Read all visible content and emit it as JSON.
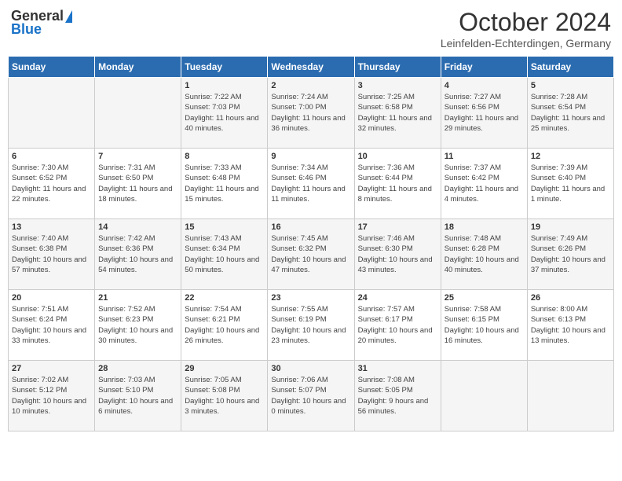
{
  "header": {
    "logo_general": "General",
    "logo_blue": "Blue",
    "month_title": "October 2024",
    "location": "Leinfelden-Echterdingen, Germany"
  },
  "days_of_week": [
    "Sunday",
    "Monday",
    "Tuesday",
    "Wednesday",
    "Thursday",
    "Friday",
    "Saturday"
  ],
  "weeks": [
    [
      {
        "day": "",
        "info": ""
      },
      {
        "day": "",
        "info": ""
      },
      {
        "day": "1",
        "info": "Sunrise: 7:22 AM\nSunset: 7:03 PM\nDaylight: 11 hours and 40 minutes."
      },
      {
        "day": "2",
        "info": "Sunrise: 7:24 AM\nSunset: 7:00 PM\nDaylight: 11 hours and 36 minutes."
      },
      {
        "day": "3",
        "info": "Sunrise: 7:25 AM\nSunset: 6:58 PM\nDaylight: 11 hours and 32 minutes."
      },
      {
        "day": "4",
        "info": "Sunrise: 7:27 AM\nSunset: 6:56 PM\nDaylight: 11 hours and 29 minutes."
      },
      {
        "day": "5",
        "info": "Sunrise: 7:28 AM\nSunset: 6:54 PM\nDaylight: 11 hours and 25 minutes."
      }
    ],
    [
      {
        "day": "6",
        "info": "Sunrise: 7:30 AM\nSunset: 6:52 PM\nDaylight: 11 hours and 22 minutes."
      },
      {
        "day": "7",
        "info": "Sunrise: 7:31 AM\nSunset: 6:50 PM\nDaylight: 11 hours and 18 minutes."
      },
      {
        "day": "8",
        "info": "Sunrise: 7:33 AM\nSunset: 6:48 PM\nDaylight: 11 hours and 15 minutes."
      },
      {
        "day": "9",
        "info": "Sunrise: 7:34 AM\nSunset: 6:46 PM\nDaylight: 11 hours and 11 minutes."
      },
      {
        "day": "10",
        "info": "Sunrise: 7:36 AM\nSunset: 6:44 PM\nDaylight: 11 hours and 8 minutes."
      },
      {
        "day": "11",
        "info": "Sunrise: 7:37 AM\nSunset: 6:42 PM\nDaylight: 11 hours and 4 minutes."
      },
      {
        "day": "12",
        "info": "Sunrise: 7:39 AM\nSunset: 6:40 PM\nDaylight: 11 hours and 1 minute."
      }
    ],
    [
      {
        "day": "13",
        "info": "Sunrise: 7:40 AM\nSunset: 6:38 PM\nDaylight: 10 hours and 57 minutes."
      },
      {
        "day": "14",
        "info": "Sunrise: 7:42 AM\nSunset: 6:36 PM\nDaylight: 10 hours and 54 minutes."
      },
      {
        "day": "15",
        "info": "Sunrise: 7:43 AM\nSunset: 6:34 PM\nDaylight: 10 hours and 50 minutes."
      },
      {
        "day": "16",
        "info": "Sunrise: 7:45 AM\nSunset: 6:32 PM\nDaylight: 10 hours and 47 minutes."
      },
      {
        "day": "17",
        "info": "Sunrise: 7:46 AM\nSunset: 6:30 PM\nDaylight: 10 hours and 43 minutes."
      },
      {
        "day": "18",
        "info": "Sunrise: 7:48 AM\nSunset: 6:28 PM\nDaylight: 10 hours and 40 minutes."
      },
      {
        "day": "19",
        "info": "Sunrise: 7:49 AM\nSunset: 6:26 PM\nDaylight: 10 hours and 37 minutes."
      }
    ],
    [
      {
        "day": "20",
        "info": "Sunrise: 7:51 AM\nSunset: 6:24 PM\nDaylight: 10 hours and 33 minutes."
      },
      {
        "day": "21",
        "info": "Sunrise: 7:52 AM\nSunset: 6:23 PM\nDaylight: 10 hours and 30 minutes."
      },
      {
        "day": "22",
        "info": "Sunrise: 7:54 AM\nSunset: 6:21 PM\nDaylight: 10 hours and 26 minutes."
      },
      {
        "day": "23",
        "info": "Sunrise: 7:55 AM\nSunset: 6:19 PM\nDaylight: 10 hours and 23 minutes."
      },
      {
        "day": "24",
        "info": "Sunrise: 7:57 AM\nSunset: 6:17 PM\nDaylight: 10 hours and 20 minutes."
      },
      {
        "day": "25",
        "info": "Sunrise: 7:58 AM\nSunset: 6:15 PM\nDaylight: 10 hours and 16 minutes."
      },
      {
        "day": "26",
        "info": "Sunrise: 8:00 AM\nSunset: 6:13 PM\nDaylight: 10 hours and 13 minutes."
      }
    ],
    [
      {
        "day": "27",
        "info": "Sunrise: 7:02 AM\nSunset: 5:12 PM\nDaylight: 10 hours and 10 minutes."
      },
      {
        "day": "28",
        "info": "Sunrise: 7:03 AM\nSunset: 5:10 PM\nDaylight: 10 hours and 6 minutes."
      },
      {
        "day": "29",
        "info": "Sunrise: 7:05 AM\nSunset: 5:08 PM\nDaylight: 10 hours and 3 minutes."
      },
      {
        "day": "30",
        "info": "Sunrise: 7:06 AM\nSunset: 5:07 PM\nDaylight: 10 hours and 0 minutes."
      },
      {
        "day": "31",
        "info": "Sunrise: 7:08 AM\nSunset: 5:05 PM\nDaylight: 9 hours and 56 minutes."
      },
      {
        "day": "",
        "info": ""
      },
      {
        "day": "",
        "info": ""
      }
    ]
  ]
}
